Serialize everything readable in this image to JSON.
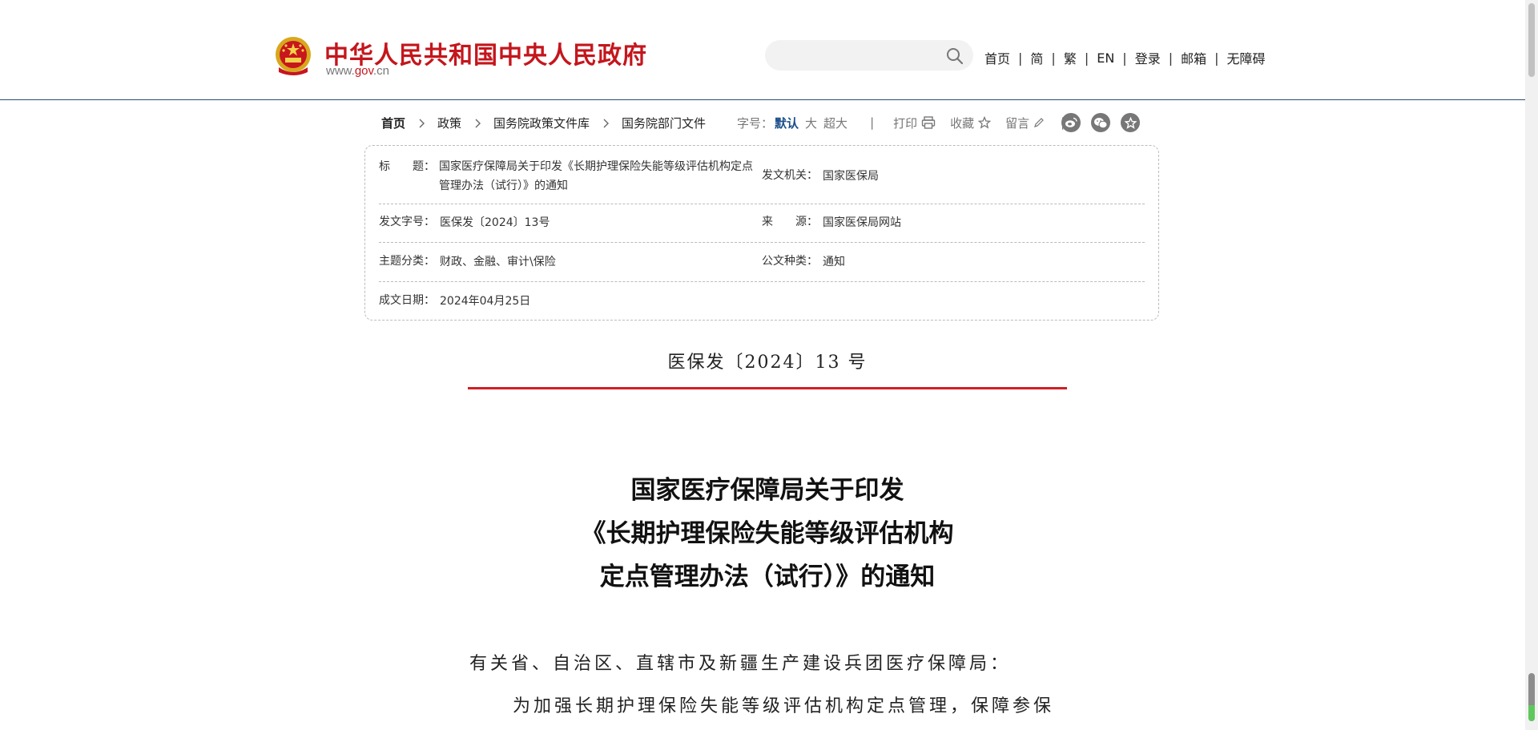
{
  "header": {
    "site_title": "中华人民共和国中央人民政府",
    "domain_prefix": "www.",
    "domain_red": "gov",
    "domain_suffix": ".cn",
    "search": {
      "placeholder": ""
    },
    "nav": [
      "首页",
      "简",
      "繁",
      "EN",
      "登录",
      "邮箱",
      "无障碍"
    ]
  },
  "breadcrumb": [
    "首页",
    "政策",
    "国务院政策文件库",
    "国务院部门文件"
  ],
  "toolbar": {
    "font_size_label": "字号：",
    "font_default": "默认",
    "font_large": "大",
    "font_xlarge": "超大",
    "separator": "|",
    "print": "打印",
    "favorite": "收藏",
    "comment": "留言"
  },
  "info": {
    "title_label": "标　　题：",
    "title_value": "国家医疗保障局关于印发《长期护理保险失能等级评估机构定点管理办法（试行）》的通知",
    "issuer_label": "发文机关：",
    "issuer_value": "国家医保局",
    "docno_label": "发文字号：",
    "docno_value": "医保发〔2024〕13号",
    "source_label": "来　　源：",
    "source_value": "国家医保局网站",
    "topic_label": "主题分类：",
    "topic_value": "财政、金融、审计\\保险",
    "doctype_label": "公文种类：",
    "doctype_value": "通知",
    "date_label": "成文日期：",
    "date_value": "2024年04月25日"
  },
  "document": {
    "number": "医保发〔2024〕13 号",
    "title_line1": "国家医疗保障局关于印发",
    "title_line2": "《长期护理保险失能等级评估机构",
    "title_line3": "定点管理办法（试行）》的通知",
    "salutation": "有关省、自治区、直辖市及新疆生产建设兵团医疗保障局：",
    "para1": "为加强长期护理保险失能等级评估机构定点管理，保障参保"
  },
  "colors": {
    "brand_red": "#c4161c",
    "header_rule": "#284c78",
    "accent_blue": "#1a4f8a",
    "doc_rule_red": "#d01f24"
  }
}
